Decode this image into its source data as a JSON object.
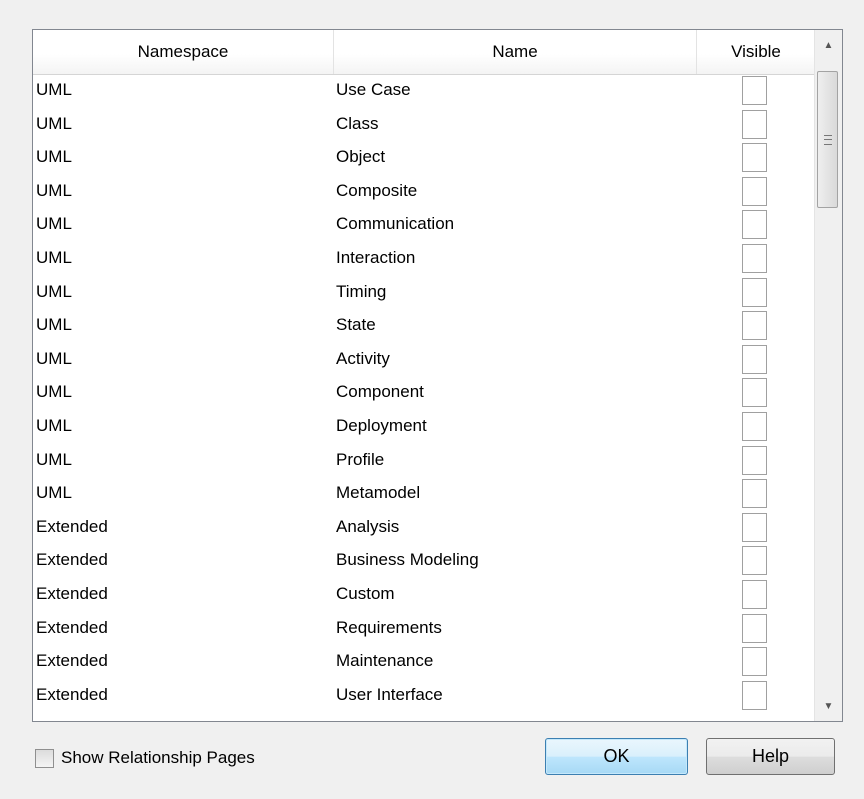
{
  "columns": {
    "namespace": "Namespace",
    "name": "Name",
    "visible": "Visible"
  },
  "rows": [
    {
      "namespace": "UML",
      "name": "Use Case",
      "visible": false
    },
    {
      "namespace": "UML",
      "name": "Class",
      "visible": false
    },
    {
      "namespace": "UML",
      "name": "Object",
      "visible": false
    },
    {
      "namespace": "UML",
      "name": "Composite",
      "visible": false
    },
    {
      "namespace": "UML",
      "name": "Communication",
      "visible": false
    },
    {
      "namespace": "UML",
      "name": "Interaction",
      "visible": false
    },
    {
      "namespace": "UML",
      "name": "Timing",
      "visible": false
    },
    {
      "namespace": "UML",
      "name": "State",
      "visible": false
    },
    {
      "namespace": "UML",
      "name": "Activity",
      "visible": false
    },
    {
      "namespace": "UML",
      "name": "Component",
      "visible": false
    },
    {
      "namespace": "UML",
      "name": "Deployment",
      "visible": false
    },
    {
      "namespace": "UML",
      "name": "Profile",
      "visible": false
    },
    {
      "namespace": "UML",
      "name": "Metamodel",
      "visible": false
    },
    {
      "namespace": "Extended",
      "name": "Analysis",
      "visible": false
    },
    {
      "namespace": "Extended",
      "name": "Business Modeling",
      "visible": false
    },
    {
      "namespace": "Extended",
      "name": "Custom",
      "visible": false
    },
    {
      "namespace": "Extended",
      "name": "Requirements",
      "visible": false
    },
    {
      "namespace": "Extended",
      "name": "Maintenance",
      "visible": false
    },
    {
      "namespace": "Extended",
      "name": "User Interface",
      "visible": false
    }
  ],
  "scrollbar": {
    "up_icon": "scroll-up-arrow",
    "down_icon": "scroll-down-arrow"
  },
  "footer": {
    "show_relationship_pages_label": "Show Relationship Pages",
    "show_relationship_pages_checked": false,
    "ok_label": "OK",
    "help_label": "Help"
  }
}
